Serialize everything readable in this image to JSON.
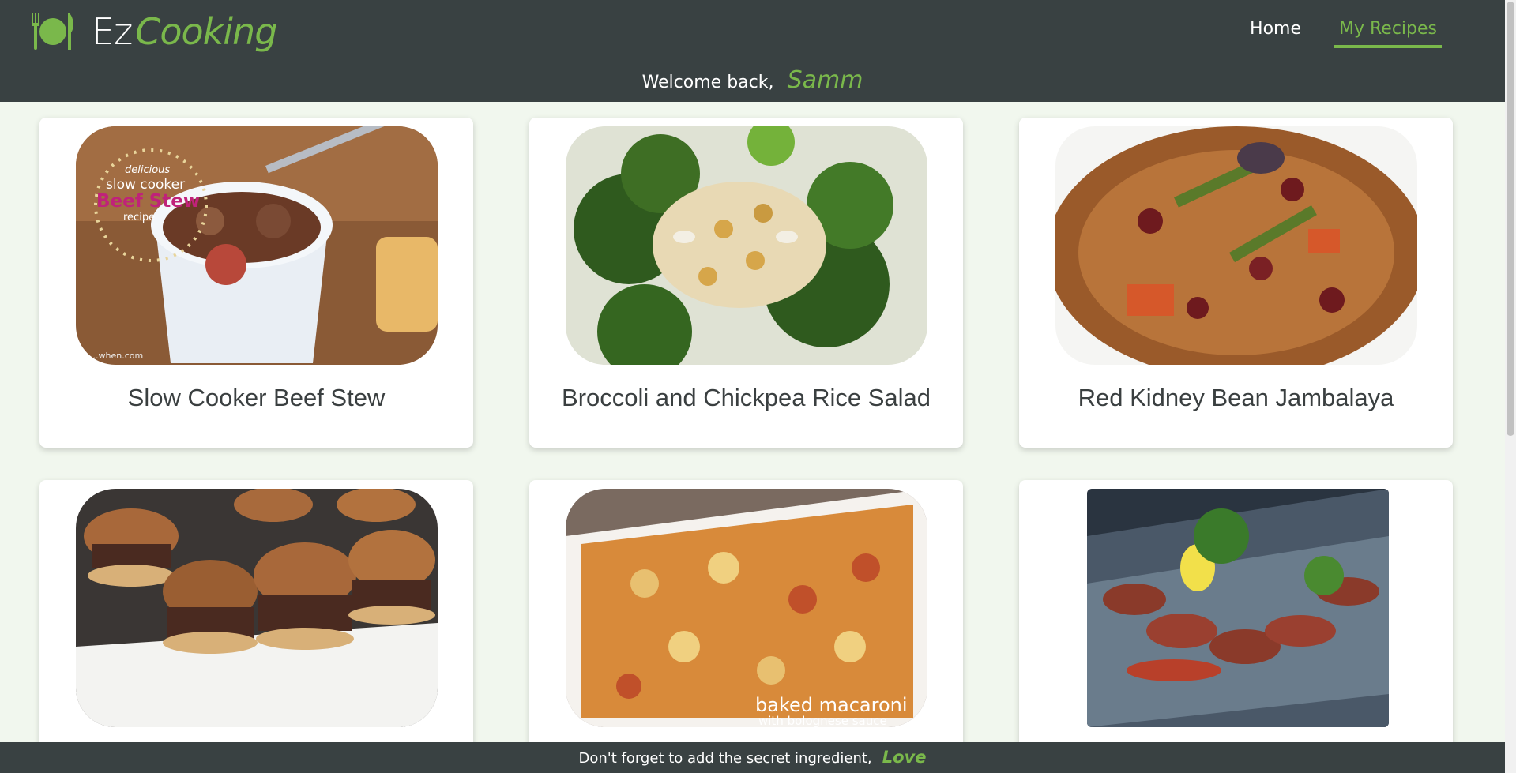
{
  "brand": {
    "ez": "Ez",
    "cooking": "Cooking",
    "icon": "plate-fork-knife-icon",
    "accent": "#7ab84b",
    "header_bg": "#394142"
  },
  "nav": {
    "home": "Home",
    "my_recipes": "My Recipes",
    "active": "My Recipes"
  },
  "welcome": {
    "text": "Welcome back,",
    "name": "Samm"
  },
  "recipes": [
    {
      "title": "Slow Cooker Beef Stew",
      "image_text": [
        "delicious",
        "slow cooker",
        "Beef Stew",
        "recipe"
      ],
      "watermark": "...when.com"
    },
    {
      "title": "Broccoli and Chickpea Rice Salad"
    },
    {
      "title": "Red Kidney Bean Jambalaya"
    },
    {
      "title": "",
      "image": "sliders-burgers"
    },
    {
      "title": "",
      "image_text": [
        "baked macaroni",
        "with bolognese sauce"
      ]
    },
    {
      "title": "",
      "image": "seared-beef-plate"
    }
  ],
  "footer": {
    "text": "Don't forget to add the secret ingredient,",
    "love": "Love"
  }
}
